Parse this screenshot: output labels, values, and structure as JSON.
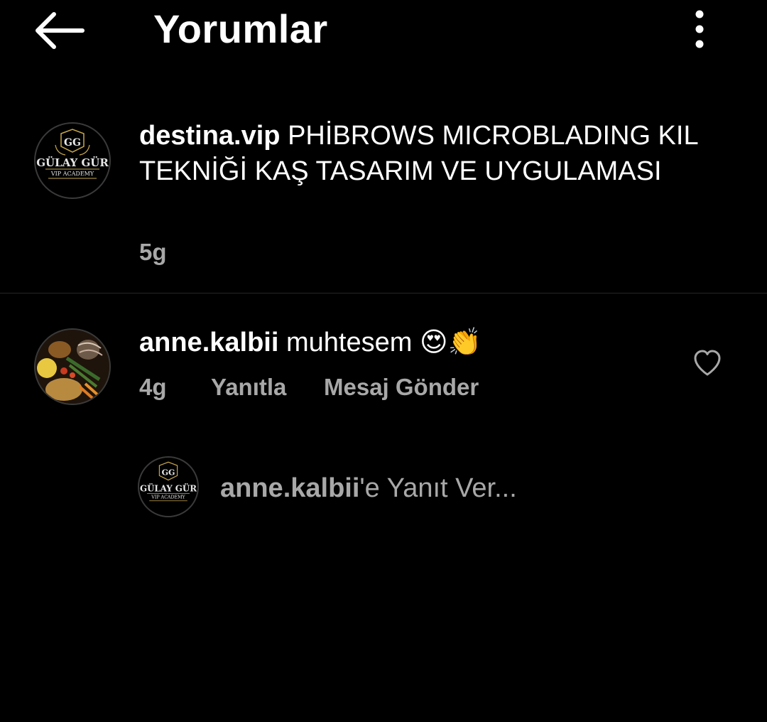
{
  "header": {
    "title": "Yorumlar",
    "back_icon": "arrow-left-icon",
    "menu_icon": "more-vertical-icon"
  },
  "caption": {
    "username": "destina.vip",
    "text": "PHİBROWS MICROBLADING KIL TEKNİĞİ KAŞ TASARIM VE UYGULAMASI",
    "time": "5g",
    "avatar_logo_text": "GÜLAY GÜR",
    "avatar_logo_sub": "VIP ACADEMY",
    "avatar_logo_mark": "GG"
  },
  "comment": {
    "username": "anne.kalbii",
    "text": "muhtesem",
    "emojis": "😍👏",
    "time": "4g",
    "reply_label": "Yanıtla",
    "message_label": "Mesaj Gönder",
    "like_icon": "heart-outline-icon"
  },
  "reply_box": {
    "mention": "anne.kalbii",
    "placeholder_rest": "'e Yanıt Ver..."
  },
  "colors": {
    "background": "#000000",
    "text": "#ffffff",
    "muted": "#a8a8a8",
    "divider": "#262626",
    "logo_gold": "#c9a74a"
  }
}
